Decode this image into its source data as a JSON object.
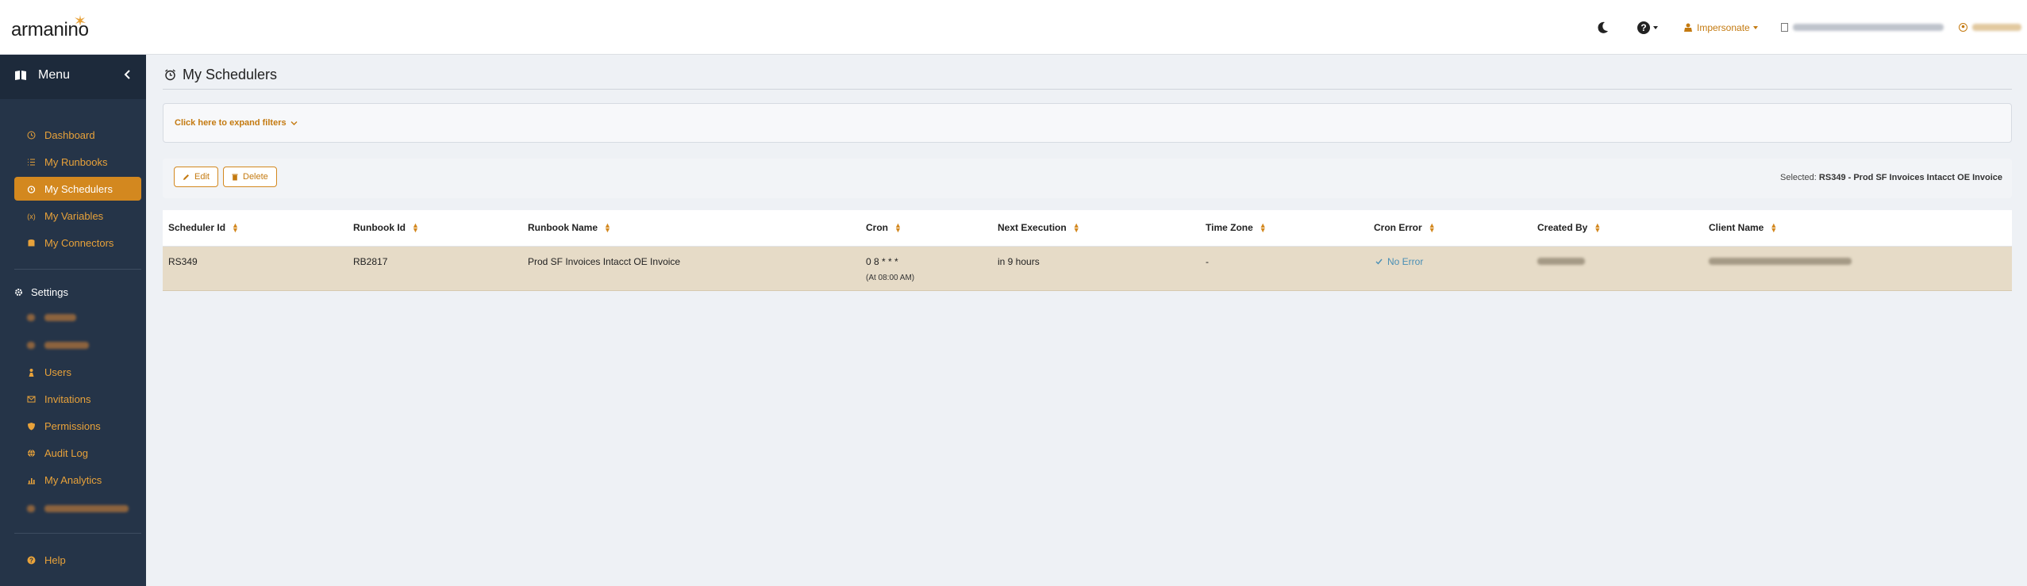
{
  "header": {
    "logo_text": "armanino",
    "impersonate_label": "Impersonate",
    "user_chip": "",
    "account_chip": ""
  },
  "sidebar": {
    "menu_title": "Menu",
    "items": [
      {
        "label": "Dashboard",
        "icon": "clock-icon",
        "active": false
      },
      {
        "label": "My Runbooks",
        "icon": "list-icon",
        "active": false
      },
      {
        "label": "My Schedulers",
        "icon": "alarm-icon",
        "active": true
      },
      {
        "label": "My Variables",
        "icon": "variable-icon",
        "active": false
      },
      {
        "label": "My Connectors",
        "icon": "database-icon",
        "active": false
      }
    ],
    "settings_title": "Settings",
    "settings_items": [
      {
        "label": "",
        "icon": "blurred-icon"
      },
      {
        "label": "",
        "icon": "blurred-icon"
      },
      {
        "label": "Users",
        "icon": "user-icon"
      },
      {
        "label": "Invitations",
        "icon": "envelope-icon"
      },
      {
        "label": "Permissions",
        "icon": "shield-icon"
      },
      {
        "label": "Audit Log",
        "icon": "globe-icon"
      },
      {
        "label": "My Analytics",
        "icon": "chart-icon"
      },
      {
        "label": "",
        "icon": "blurred-icon"
      }
    ],
    "help_label": "Help"
  },
  "main": {
    "page_title": "My Schedulers",
    "filters_label": "Click here to expand filters",
    "toolbar": {
      "edit_label": "Edit",
      "delete_label": "Delete",
      "selected_prefix": "Selected:",
      "selected_value": "RS349 - Prod SF Invoices Intacct OE Invoice"
    },
    "table": {
      "columns": [
        "Scheduler Id",
        "Runbook Id",
        "Runbook Name",
        "Cron",
        "Next Execution",
        "Time Zone",
        "Cron Error",
        "Created By",
        "Client Name"
      ],
      "rows": [
        {
          "scheduler_id": "RS349",
          "runbook_id": "RB2817",
          "runbook_name": "Prod SF Invoices Intacct OE Invoice",
          "cron": "0 8 * * *",
          "cron_human": "(At 08:00 AM)",
          "next_execution": "in 9 hours",
          "time_zone": "-",
          "cron_error": "No Error",
          "created_by": "",
          "client_name": ""
        }
      ]
    }
  },
  "colors": {
    "accent": "#d3881f",
    "sidebar_bg": "#253448",
    "selected_row": "#e6dbc7",
    "no_error": "#4a8fb5"
  }
}
